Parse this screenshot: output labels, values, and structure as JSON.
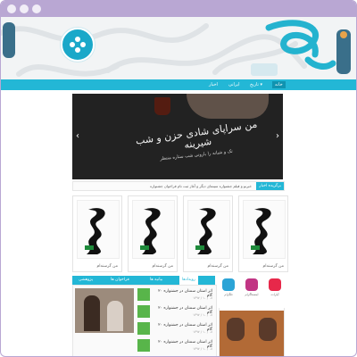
{
  "logo": {
    "caption": ""
  },
  "nav": {
    "items": [
      {
        "label": "خانه",
        "active": true
      },
      {
        "label": "تاریخ",
        "active": false,
        "has_dropdown": true
      },
      {
        "label": "ایرانی",
        "active": false
      },
      {
        "label": "اخبار",
        "active": false
      }
    ]
  },
  "hero": {
    "title": "من سراپای شادی حزن و شب شیرینه",
    "subtitle": "تک و شبانه را بارونی شب ستاره منتظر",
    "prev_arrow": "‹",
    "next_arrow": "›"
  },
  "ticker": {
    "label": "برگزیده اخبار",
    "text": "خبرنو و فیلم جشنواره سینمای دیگر و آغاز ثبت نام فراخوان جشنواره"
  },
  "cards": [
    {
      "title": "من گرسنه‌ام"
    },
    {
      "title": "من گرسنه‌ام"
    },
    {
      "title": "من گرسنه‌ام"
    },
    {
      "title": "من گرسنه‌ام"
    }
  ],
  "tabs": {
    "items": [
      {
        "label": "پژوهشی",
        "active": false
      },
      {
        "label": "فراخوان ها",
        "active": false
      },
      {
        "label": "بیانیه ها",
        "active": false
      },
      {
        "label": "رویدادها",
        "active": true
      }
    ]
  },
  "news": {
    "items": [
      {
        "text": "۲۰ اثر استان سمنان در جشنواره گام",
        "date": "۱۳۹۷ / ۱۰ / ۰۸"
      },
      {
        "text": "۲۰ اثر استان سمنان در جشنواره گام",
        "date": "۱۳۹۷ / ۱۰ / ۰۸"
      },
      {
        "text": "۲۰ اثر استان سمنان در جشنواره گام",
        "date": "۱۳۹۷ / ۱۰ / ۰۸"
      },
      {
        "text": "۲۰ اثر استان سمنان در جشنواره گام",
        "date": "۱۳۹۷ / ۱۰ / ۰۸"
      }
    ]
  },
  "side_news": {
    "title": "اخبار اخیر",
    "items": [
      "",
      "",
      "",
      ""
    ]
  },
  "social": {
    "items": [
      {
        "name": "telegram-icon",
        "label": "تلگرام",
        "color": "#2ba4d6"
      },
      {
        "name": "instagram-icon",
        "label": "اینستاگرام",
        "color": "#c13584"
      },
      {
        "name": "app-icon",
        "label": "آپارات",
        "color": "#e7284a"
      }
    ]
  },
  "colors": {
    "accent": "#23b7d6",
    "accent_dark": "#1093b0",
    "frame": "#b9a7d3",
    "thumb_green": "#58b54a"
  }
}
